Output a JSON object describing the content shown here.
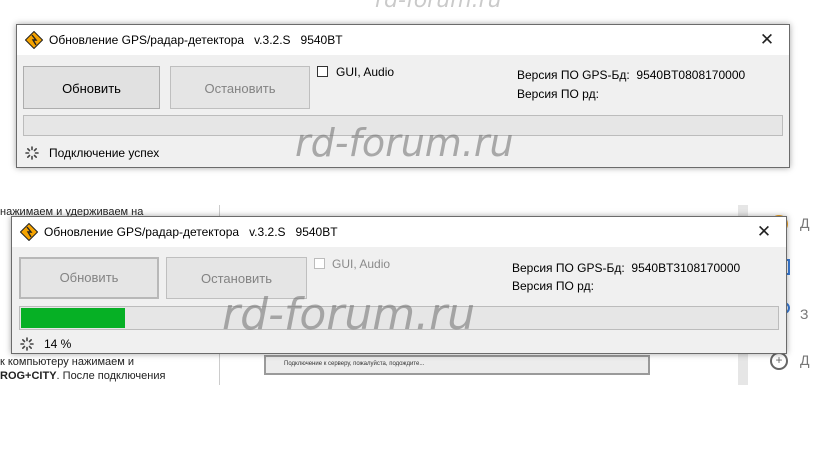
{
  "watermark_top": "rd-forum.ru",
  "watermark_main": "rd-forum.ru",
  "background": {
    "lines": [
      "нажимаем и удерживаем на",
      "к компьютеру нажимаем и"
    ],
    "bold_fragment": "ROG+CITY",
    "after_bold": ". После подключения",
    "status_dialog": "Подключение к серверу, пожалуйста, подождите...",
    "right_letters": [
      "Д",
      "З",
      "Д"
    ]
  },
  "window1": {
    "title": "Обновление GPS/радар-детектора   v.3.2.S   9540BT",
    "close_glyph": "✕",
    "update_button": "Обновить",
    "stop_button": "Остановить",
    "checkbox_label": "GUI, Audio",
    "gps_version_label": "Версия ПО GPS-Бд:  9540BT0808170000",
    "rd_version_label": "Версия ПО рд:",
    "status_text": "Подключение успех",
    "progress_percent": 0,
    "watermark": "rd-forum.ru"
  },
  "window2": {
    "title": "Обновление GPS/радар-детектора   v.3.2.S   9540BT",
    "close_glyph": "✕",
    "update_button": "Обновить",
    "stop_button": "Остановить",
    "checkbox_label": "GUI, Audio",
    "gps_version_label": "Версия ПО GPS-Бд:  9540BT3108170000",
    "rd_version_label": "Версия ПО рд:",
    "status_text": "14 %",
    "progress_percent": 14,
    "watermark": "rd-forum.ru"
  },
  "colors": {
    "progress_fill": "#06b025",
    "window_bg": "#f0f0f0"
  }
}
